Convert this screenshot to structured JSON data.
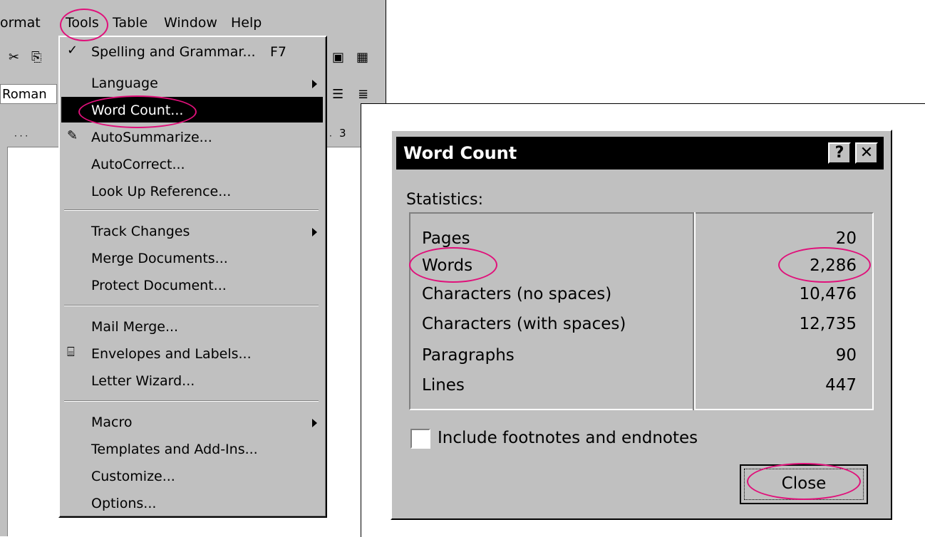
{
  "menubar": {
    "items": [
      "ormat",
      "Tools",
      "Table",
      "Window",
      "Help"
    ]
  },
  "toolbar": {
    "font_name": "Roman",
    "ruler_number": "3"
  },
  "tools_menu": {
    "items": [
      {
        "label": "Spelling and Grammar...",
        "shortcut": "F7"
      },
      {
        "label": "Language"
      },
      {
        "label": "Word Count..."
      },
      {
        "label": "AutoSummarize..."
      },
      {
        "label": "AutoCorrect..."
      },
      {
        "label": "Look Up Reference..."
      },
      {
        "label": "Track Changes"
      },
      {
        "label": "Merge Documents..."
      },
      {
        "label": "Protect Document..."
      },
      {
        "label": "Mail Merge..."
      },
      {
        "label": "Envelopes and Labels..."
      },
      {
        "label": "Letter Wizard..."
      },
      {
        "label": "Macro"
      },
      {
        "label": "Templates and Add-Ins..."
      },
      {
        "label": "Customize..."
      },
      {
        "label": "Options..."
      }
    ]
  },
  "dialog": {
    "title": "Word Count",
    "help_label": "?",
    "close_x_label": "✕",
    "stats_label": "Statistics:",
    "rows": [
      {
        "label": "Pages",
        "value": "20"
      },
      {
        "label": "Words",
        "value": "2,286"
      },
      {
        "label": "Characters (no spaces)",
        "value": "10,476"
      },
      {
        "label": "Characters (with spaces)",
        "value": "12,735"
      },
      {
        "label": "Paragraphs",
        "value": "90"
      },
      {
        "label": "Lines",
        "value": "447"
      }
    ],
    "checkbox_label": "Include footnotes and endnotes",
    "checkbox_checked": false,
    "close_button_label": "Close"
  },
  "colors": {
    "highlight_circle": "#e0107a",
    "menu_selected_bg": "#000000",
    "window_bg": "#c0c0c0"
  }
}
